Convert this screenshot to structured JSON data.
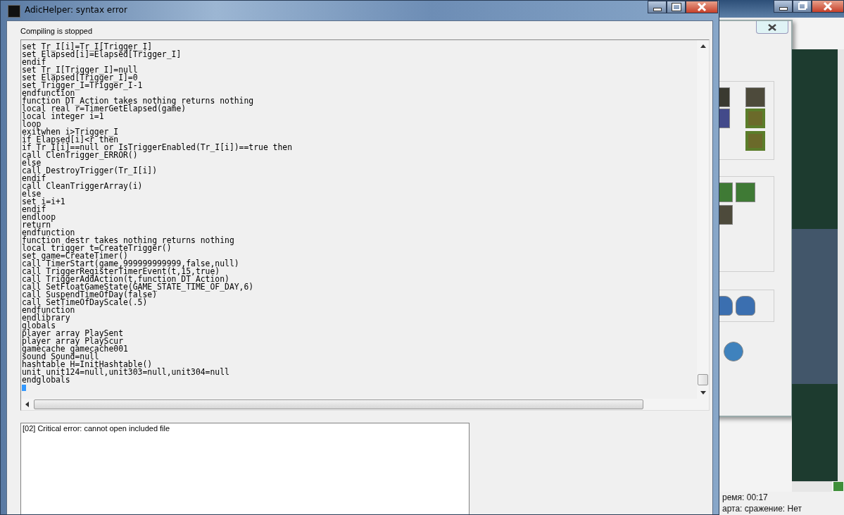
{
  "main_window": {
    "title": "AdicHelper: syntax error",
    "status": "Compiling is stopped",
    "code_lines": [
      "set Tr_I[i]=Tr_I[Trigger_I]",
      "set Elapsed[i]=Elapsed[Trigger_I]",
      "endif",
      "set Tr_I[Trigger_I]=null",
      "set Elapsed[Trigger_I]=0",
      "set Trigger_I=Trigger_I-1",
      "endfunction",
      "function DT_Action takes nothing returns nothing",
      "local real r=TimerGetElapsed(game)",
      "local integer i=1",
      "loop",
      "exitwhen i>Trigger_I",
      "if Elapsed[i]<r then",
      "if Tr_I[i]==null or IsTriggerEnabled(Tr_I[i])==true then",
      "call ClenTrigger_ERROR()",
      "else",
      "call DestroyTrigger(Tr_I[i])",
      "endif",
      "call CleanTriggerArray(i)",
      "else",
      "set i=i+1",
      "endif",
      "endloop",
      "return",
      "endfunction",
      "function destr takes nothing returns nothing",
      "local trigger t=CreateTrigger()",
      "set game=CreateTimer()",
      "call TimerStart(game,999999999999,false,null)",
      "call TriggerRegisterTimerEvent(t,15,true)",
      "call TriggerAddAction(t,function DT_Action)",
      "call SetFloatGameState(GAME_STATE_TIME_OF_DAY,6)",
      "call SuspendTimeOfDay(false)",
      "call SetTimeOfDayScale(.5)",
      "endfunction",
      "endlibrary",
      "globals",
      "player array PlaySent",
      "player array PlayScur",
      "gamecache gamecache001",
      "sound Sound=null",
      "hashtable H=InitHashtable()",
      "unit unit124=null,unit303=null,unit304=null",
      "endglobals"
    ],
    "messages": [
      "[02] Critical error: cannot open included file"
    ]
  },
  "background_window": {
    "status_lines": [
      "ремя: 00:17",
      "арта: сражение: Нет"
    ]
  }
}
